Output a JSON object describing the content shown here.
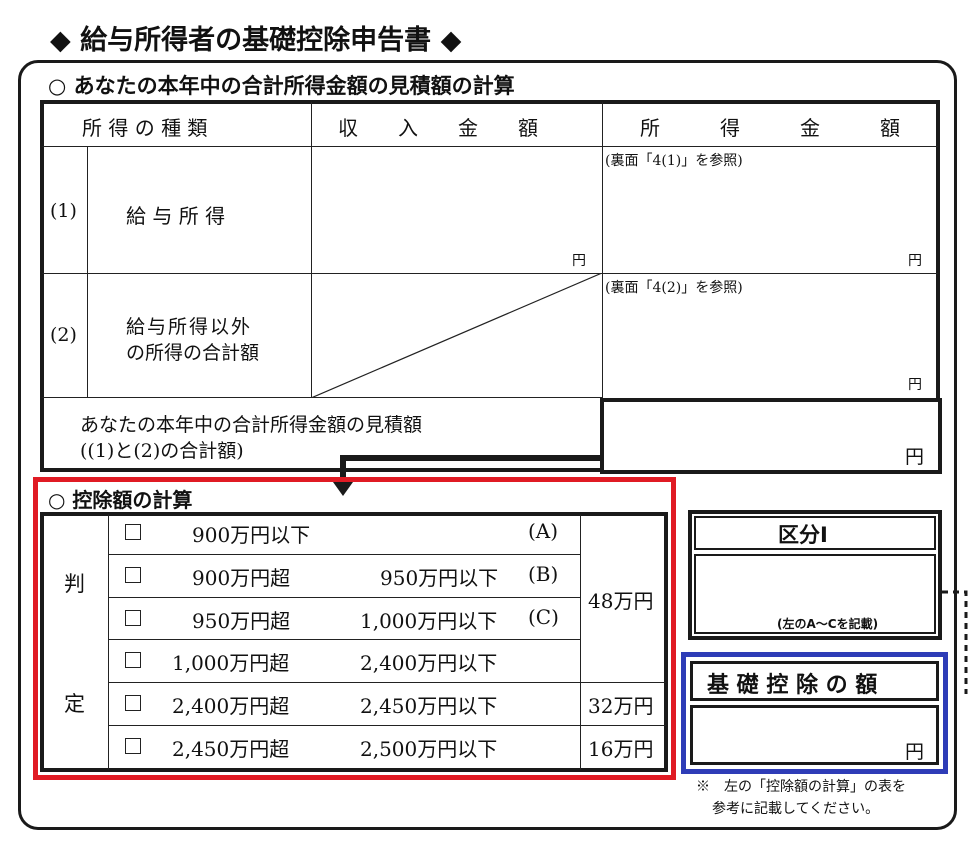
{
  "form": {
    "title": "◆ 給与所得者の基礎控除申告書 ◆",
    "income_section": {
      "heading": "○ あなたの本年中の合計所得金額の見積額の計算",
      "col_type": "所 得 の 種 類",
      "col_income": "収　　入　　金　　額",
      "col_amount": "所　　　得　　　金　　　額",
      "row1_num": "(1)",
      "row1_label": "給 与 所 得",
      "row1_ref": "(裏面「4(1)」を参照)",
      "row2_num": "(2)",
      "row2_label_1": "給与所得以外",
      "row2_label_2": "の所得の合計額",
      "row2_ref": "(裏面「4(2)」を参照)",
      "total_label_1": "あなたの本年中の合計所得金額の見積額",
      "total_label_2": "((1)と(2)の合計額)",
      "yen": "円"
    },
    "deduction_section": {
      "heading": "○ 控除額の計算",
      "judge_1": "判",
      "judge_2": "定",
      "rows": [
        {
          "from": "900万円以下",
          "to": "",
          "tag": "(A)"
        },
        {
          "from": "900万円超",
          "to": "950万円以下",
          "tag": "(B)"
        },
        {
          "from": "950万円超",
          "to": "1,000万円以下",
          "tag": "(C)"
        },
        {
          "from": "1,000万円超",
          "to": "2,400万円以下",
          "tag": ""
        },
        {
          "from": "2,400万円超",
          "to": "2,450万円以下",
          "tag": ""
        },
        {
          "from": "2,450万円超",
          "to": "2,500万円以下",
          "tag": ""
        }
      ],
      "amount_48": "48万円",
      "amount_32": "32万円",
      "amount_16": "16万円",
      "checkbox_symbol": "☐"
    },
    "category_box": {
      "title": "区分Ⅰ",
      "note": "(左のA～Cを記載)"
    },
    "basic_deduction_box": {
      "title": "基 礎 控 除 の 額",
      "yen": "円"
    },
    "footnote_1": "※　左の「控除額の計算」の表を",
    "footnote_2": "参考に記載してください。"
  }
}
